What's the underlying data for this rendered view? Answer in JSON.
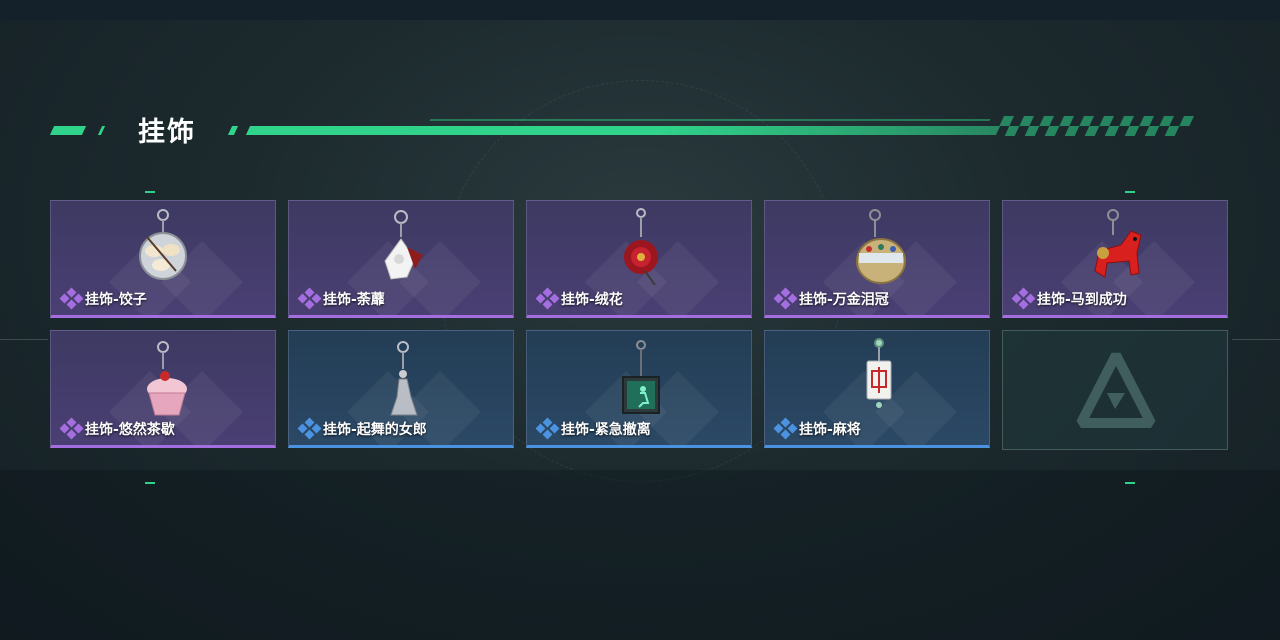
{
  "section": {
    "title": "挂饰"
  },
  "colors": {
    "accent": "#2fd38a",
    "rarity_purple": "#a46ee0",
    "rarity_blue": "#4b93e0"
  },
  "items": [
    {
      "name": "挂饰-饺子",
      "rarity": "purple",
      "icon": "dumplings-plate-charm"
    },
    {
      "name": "挂饰-荼蘼",
      "rarity": "purple",
      "icon": "white-flower-charm"
    },
    {
      "name": "挂饰-绒花",
      "rarity": "purple",
      "icon": "red-velvet-flower-charm"
    },
    {
      "name": "挂饰-万金泪冠",
      "rarity": "purple",
      "icon": "jeweled-crown-charm"
    },
    {
      "name": "挂饰-马到成功",
      "rarity": "purple",
      "icon": "red-horse-charm"
    },
    {
      "name": "挂饰-悠然茶歇",
      "rarity": "purple",
      "icon": "cupcake-charm"
    },
    {
      "name": "挂饰-起舞的女郎",
      "rarity": "blue",
      "icon": "dancing-lady-charm"
    },
    {
      "name": "挂饰-紧急撤离",
      "rarity": "blue",
      "icon": "emergency-exit-sign-charm"
    },
    {
      "name": "挂饰-麻将",
      "rarity": "blue",
      "icon": "mahjong-tile-charm"
    }
  ],
  "empty_slot": {
    "icon": "game-logo-icon"
  }
}
